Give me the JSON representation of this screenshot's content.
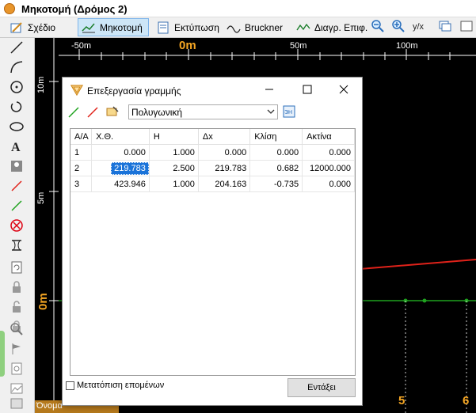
{
  "window": {
    "title": "Μηκοτομή (Δρόμος 2)"
  },
  "toolbar": {
    "items": [
      {
        "label": "Σχέδιο",
        "icon": "pencil-ruler-icon"
      },
      {
        "label": "Μηκοτομή",
        "icon": "profile-icon",
        "active": true
      },
      {
        "label": "Εκτύπωση",
        "icon": "print-icon"
      },
      {
        "label": "Bruckner",
        "icon": "bruckner-icon"
      },
      {
        "label": "Διαγρ. Επιφ.",
        "icon": "surface-diagram-icon"
      }
    ]
  },
  "rulers": {
    "top_labels": [
      "-50m",
      "0m",
      "50m",
      "100m"
    ],
    "left_labels": [
      "10m",
      "5m",
      "0m"
    ],
    "bottom_labels": [
      "5",
      "6"
    ]
  },
  "statusbar": {
    "left_text": "Όνομα"
  },
  "dialog": {
    "title": "Επεξεργασία γραμμής",
    "type_select": "Πολυγωνική",
    "columns": [
      "Α/Α",
      "Χ.Θ.",
      "Η",
      "Δx",
      "Κλίση",
      "Ακτίνα"
    ],
    "rows": [
      [
        "1",
        "0.000",
        "1.000",
        "0.000",
        "0.000",
        "0.000"
      ],
      [
        "2",
        "219.783",
        "2.500",
        "219.783",
        "0.682",
        "12000.000"
      ],
      [
        "3",
        "423.946",
        "1.000",
        "204.163",
        "-0.735",
        "0.000"
      ]
    ],
    "shift_next_label": "Μετατόπιση επομένων",
    "ok_label": "Εντάξει"
  },
  "colors": {
    "accent_orange": "#f5a623",
    "profile_red": "#e0221a",
    "profile_green": "#1fa31f",
    "selection_blue": "#1a73d9"
  }
}
